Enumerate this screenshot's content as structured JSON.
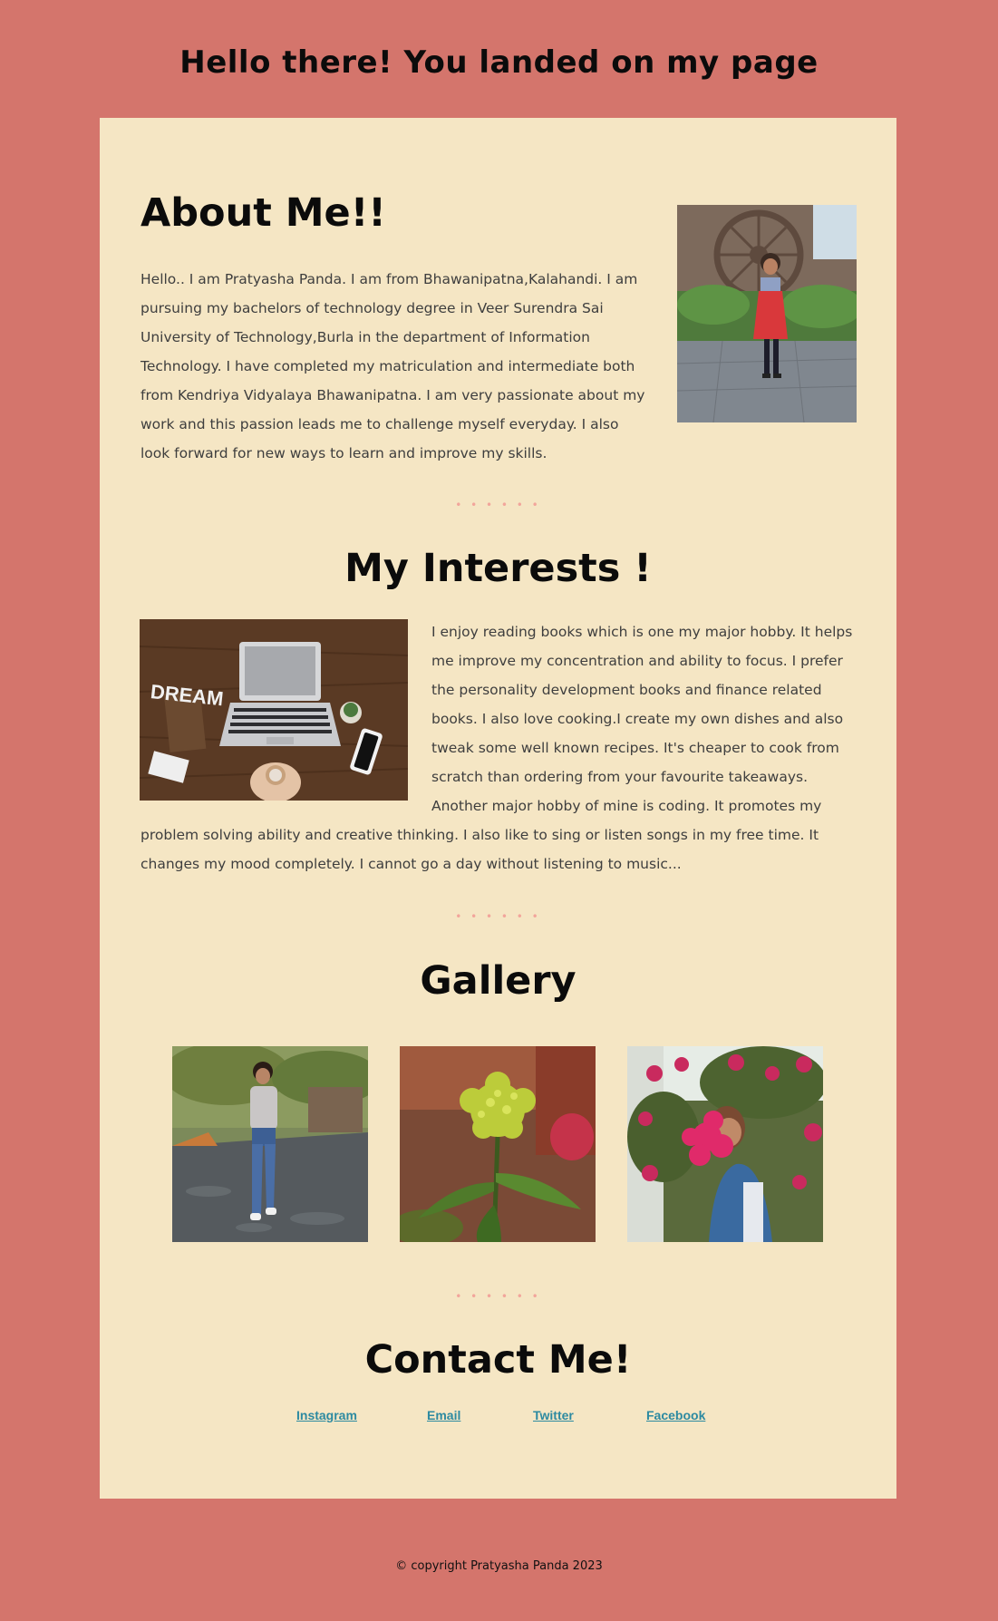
{
  "header": {
    "title": "Hello there! You landed on my page"
  },
  "about": {
    "title": "About Me!!",
    "text": "Hello.. I am Pratyasha Panda. I am from Bhawanipatna,Kalahandi. I am pursuing my bachelors of technology degree in Veer Surendra Sai University of Technology,Burla in the department of Information Technology. I have completed my matriculation and intermediate both from Kendriya Vidyalaya Bhawanipatna. I am very passionate about my work and this passion leads me to challenge myself everyday. I also look forward for new ways to learn and improve my skills.",
    "photo_icon": "profile-photo"
  },
  "divider": "• • • • • •",
  "interests": {
    "title": "My Interests !",
    "text": "I enjoy reading books which is one my major hobby. It helps me improve my concentration and ability to focus. I prefer the personality development books and finance related books. I also love cooking.I create my own dishes and also tweak some well known recipes. It's cheaper to cook from scratch than ordering from your favourite takeaways. Another major hobby of mine is coding. It promotes my problem solving ability and creative thinking. I also like to sing or listen songs in my free time. It changes my mood completely. I cannot go a day without listening to music...",
    "image_text": "DREAM"
  },
  "gallery": {
    "title": "Gallery"
  },
  "contact": {
    "title": "Contact Me!",
    "links": [
      "Instagram",
      "Email",
      "Twitter",
      "Facebook"
    ]
  },
  "footer": {
    "text": "© copyright Pratyasha Panda 2023"
  },
  "colors": {
    "background": "#d4756c",
    "card": "#f5e6c4",
    "link": "#2d8aa1",
    "divider": "#f2a59b"
  }
}
